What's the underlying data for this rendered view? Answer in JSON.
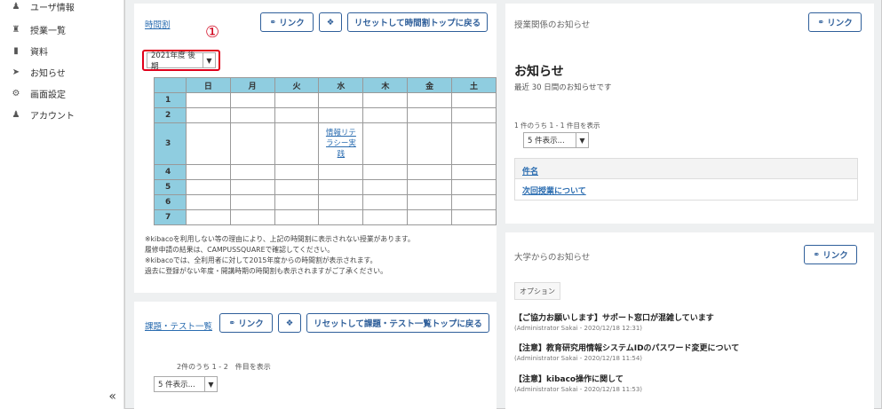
{
  "sidebar": {
    "items": [
      {
        "icon": "user-icon",
        "label": "ユーザ情報"
      },
      {
        "icon": "graduation-cap-icon",
        "label": "授業一覧"
      },
      {
        "icon": "folder-icon",
        "label": "資料"
      },
      {
        "icon": "megaphone-icon",
        "label": "お知らせ"
      },
      {
        "icon": "gear-icon",
        "label": "画面設定"
      },
      {
        "icon": "user-icon",
        "label": "アカウント"
      }
    ],
    "collapse": "«"
  },
  "timetable": {
    "title": "時間割",
    "link_button": "リンク",
    "reset_button": "リセットして時間割トップに戻る",
    "marker": "①",
    "term_select": "2021年度 後期",
    "days": [
      "日",
      "月",
      "火",
      "水",
      "木",
      "金",
      "土"
    ],
    "periods": [
      "1",
      "2",
      "3",
      "4",
      "5",
      "6",
      "7"
    ],
    "course": "情報リテラシー実践",
    "notes": [
      "※kibacoを利用しない等の理由により、上記の時間割に表示されない授業があります。",
      "履修申請の結果は、CAMPUSSQUAREで確認してください。",
      "※kibacoでは、全利用者に対して2015年度からの時間割が表示されます。",
      "過去に登録がない年度・開講時期の時間割も表示されますがご了承ください。"
    ]
  },
  "assignments": {
    "title": "課題・テスト一覧",
    "link_button": "リンク",
    "reset_button": "リセットして課題・テスト一覧トップに戻る",
    "count": "2件のうち 1 - 2　件目を表示",
    "page_size": "5 件表示..."
  },
  "class_notices": {
    "title": "授業関係のお知らせ",
    "link_button": "リンク",
    "heading": "お知らせ",
    "subheading": "最近 30 日間のお知らせです",
    "count": "1 件のうち 1 - 1 件目を表示",
    "page_size": "5 件表示...",
    "column": "件名",
    "rows": [
      "次回授業について"
    ]
  },
  "university_notices": {
    "title": "大学からのお知らせ",
    "link_button": "リンク",
    "options_tab": "オプション",
    "items": [
      {
        "title": "【ご協力お願いします】サポート窓口が混雑しています",
        "meta": "(Administrator Sakai - 2020/12/18 12:31)"
      },
      {
        "title": "【注意】教育研究用情報システムIDのパスワード変更について",
        "meta": "(Administrator Sakai - 2020/12/18 11:54)"
      },
      {
        "title": "【注意】kibaco操作に関して",
        "meta": "(Administrator Sakai - 2020/12/18 11:53)"
      }
    ]
  },
  "colors": {
    "accent": "#2f5f9a",
    "header_cell": "#8fcde0",
    "highlight": "#e0001b"
  }
}
